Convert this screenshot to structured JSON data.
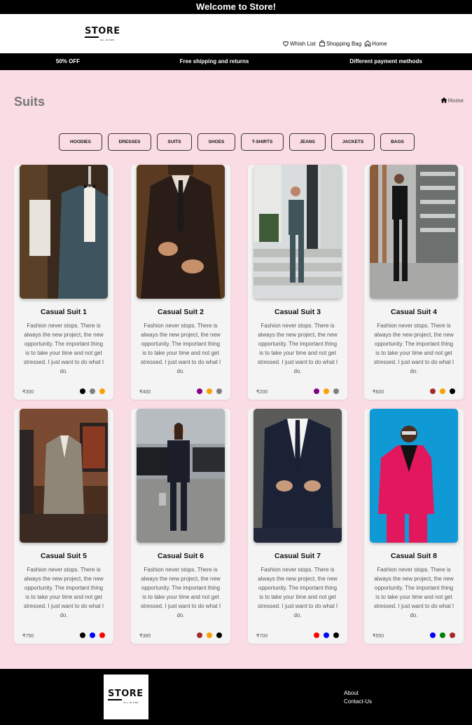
{
  "topbar": {
    "text": "Welcome to Store!"
  },
  "header": {
    "logo": {
      "name": "STORE",
      "tagline": "ALL IN ONE"
    },
    "nav": [
      {
        "label": "Whish List",
        "icon": "heart-icon"
      },
      {
        "label": "Shopping Bag",
        "icon": "bag-icon"
      },
      {
        "label": "Home",
        "icon": "home-icon"
      }
    ]
  },
  "promo": {
    "items": [
      "50% OFF",
      "Free shipping and returns",
      "Different payment methods"
    ]
  },
  "page": {
    "title": "Suits",
    "breadcrumb": "Home"
  },
  "categories": [
    "HOODIES",
    "DRESSES",
    "SUITS",
    "SHOES",
    "T-SHIRTS",
    "JEANS",
    "JACKETS",
    "BAGS"
  ],
  "products": [
    {
      "title": "Casual Suit 1",
      "desc": "Fashion never stops. There is always the new project, the new opportunity. The important thing is to take your time and not get stressed. I just want to do what I do.",
      "price": "₹300",
      "colors": [
        "#000000",
        "#808080",
        "#f5a300"
      ]
    },
    {
      "title": "Casual Suit 2",
      "desc": "Fashion never stops. There is always the new project, the new opportunity. The important thing is to take your time and not get stressed. I just want to do what I do.",
      "price": "₹400",
      "colors": [
        "#800080",
        "#f5a300",
        "#808080"
      ]
    },
    {
      "title": "Casual Suit 3",
      "desc": "Fashion never stops. There is always the new project, the new opportunity. The important thing is to take your time and not get stressed. I just want to do what I do.",
      "price": "₹200",
      "colors": [
        "#800080",
        "#f5a300",
        "#808080"
      ]
    },
    {
      "title": "Casual Suit 4",
      "desc": "Fashion never stops. There is always the new project, the new opportunity. The important thing is to take your time and not get stressed. I just want to do what I do.",
      "price": "₹600",
      "colors": [
        "#a52a2a",
        "#f5a300",
        "#000000"
      ]
    },
    {
      "title": "Casual Suit 5",
      "desc": "Fashion never stops. There is always the new project, the new opportunity. The important thing is to take your time and not get stressed. I just want to do what I do.",
      "price": "₹750",
      "colors": [
        "#000000",
        "#0000ff",
        "#ff0000"
      ]
    },
    {
      "title": "Casual Suit 6",
      "desc": "Fashion never stops. There is always the new project, the new opportunity. The important thing is to take your time and not get stressed. I just want to do what I do.",
      "price": "₹385",
      "colors": [
        "#a52a2a",
        "#f5a300",
        "#000000"
      ]
    },
    {
      "title": "Casual Suit 7",
      "desc": "Fashion never stops. There is always the new project, the new opportunity. The important thing is to take your time and not get stressed. I just want to do what I do.",
      "price": "₹700",
      "colors": [
        "#ff0000",
        "#0000ff",
        "#000000"
      ]
    },
    {
      "title": "Casual Suit 8",
      "desc": "Fashion never stops. There is always the new project, the new opportunity. The important thing is to take your time and not get stressed. I just want to do what I do.",
      "price": "₹550",
      "colors": [
        "#0000ff",
        "#008000",
        "#a52a2a"
      ]
    }
  ],
  "footer": {
    "logo": {
      "name": "STORE",
      "tagline": "ALL IN ONE"
    },
    "links": [
      "About",
      "Contact-Us"
    ]
  }
}
